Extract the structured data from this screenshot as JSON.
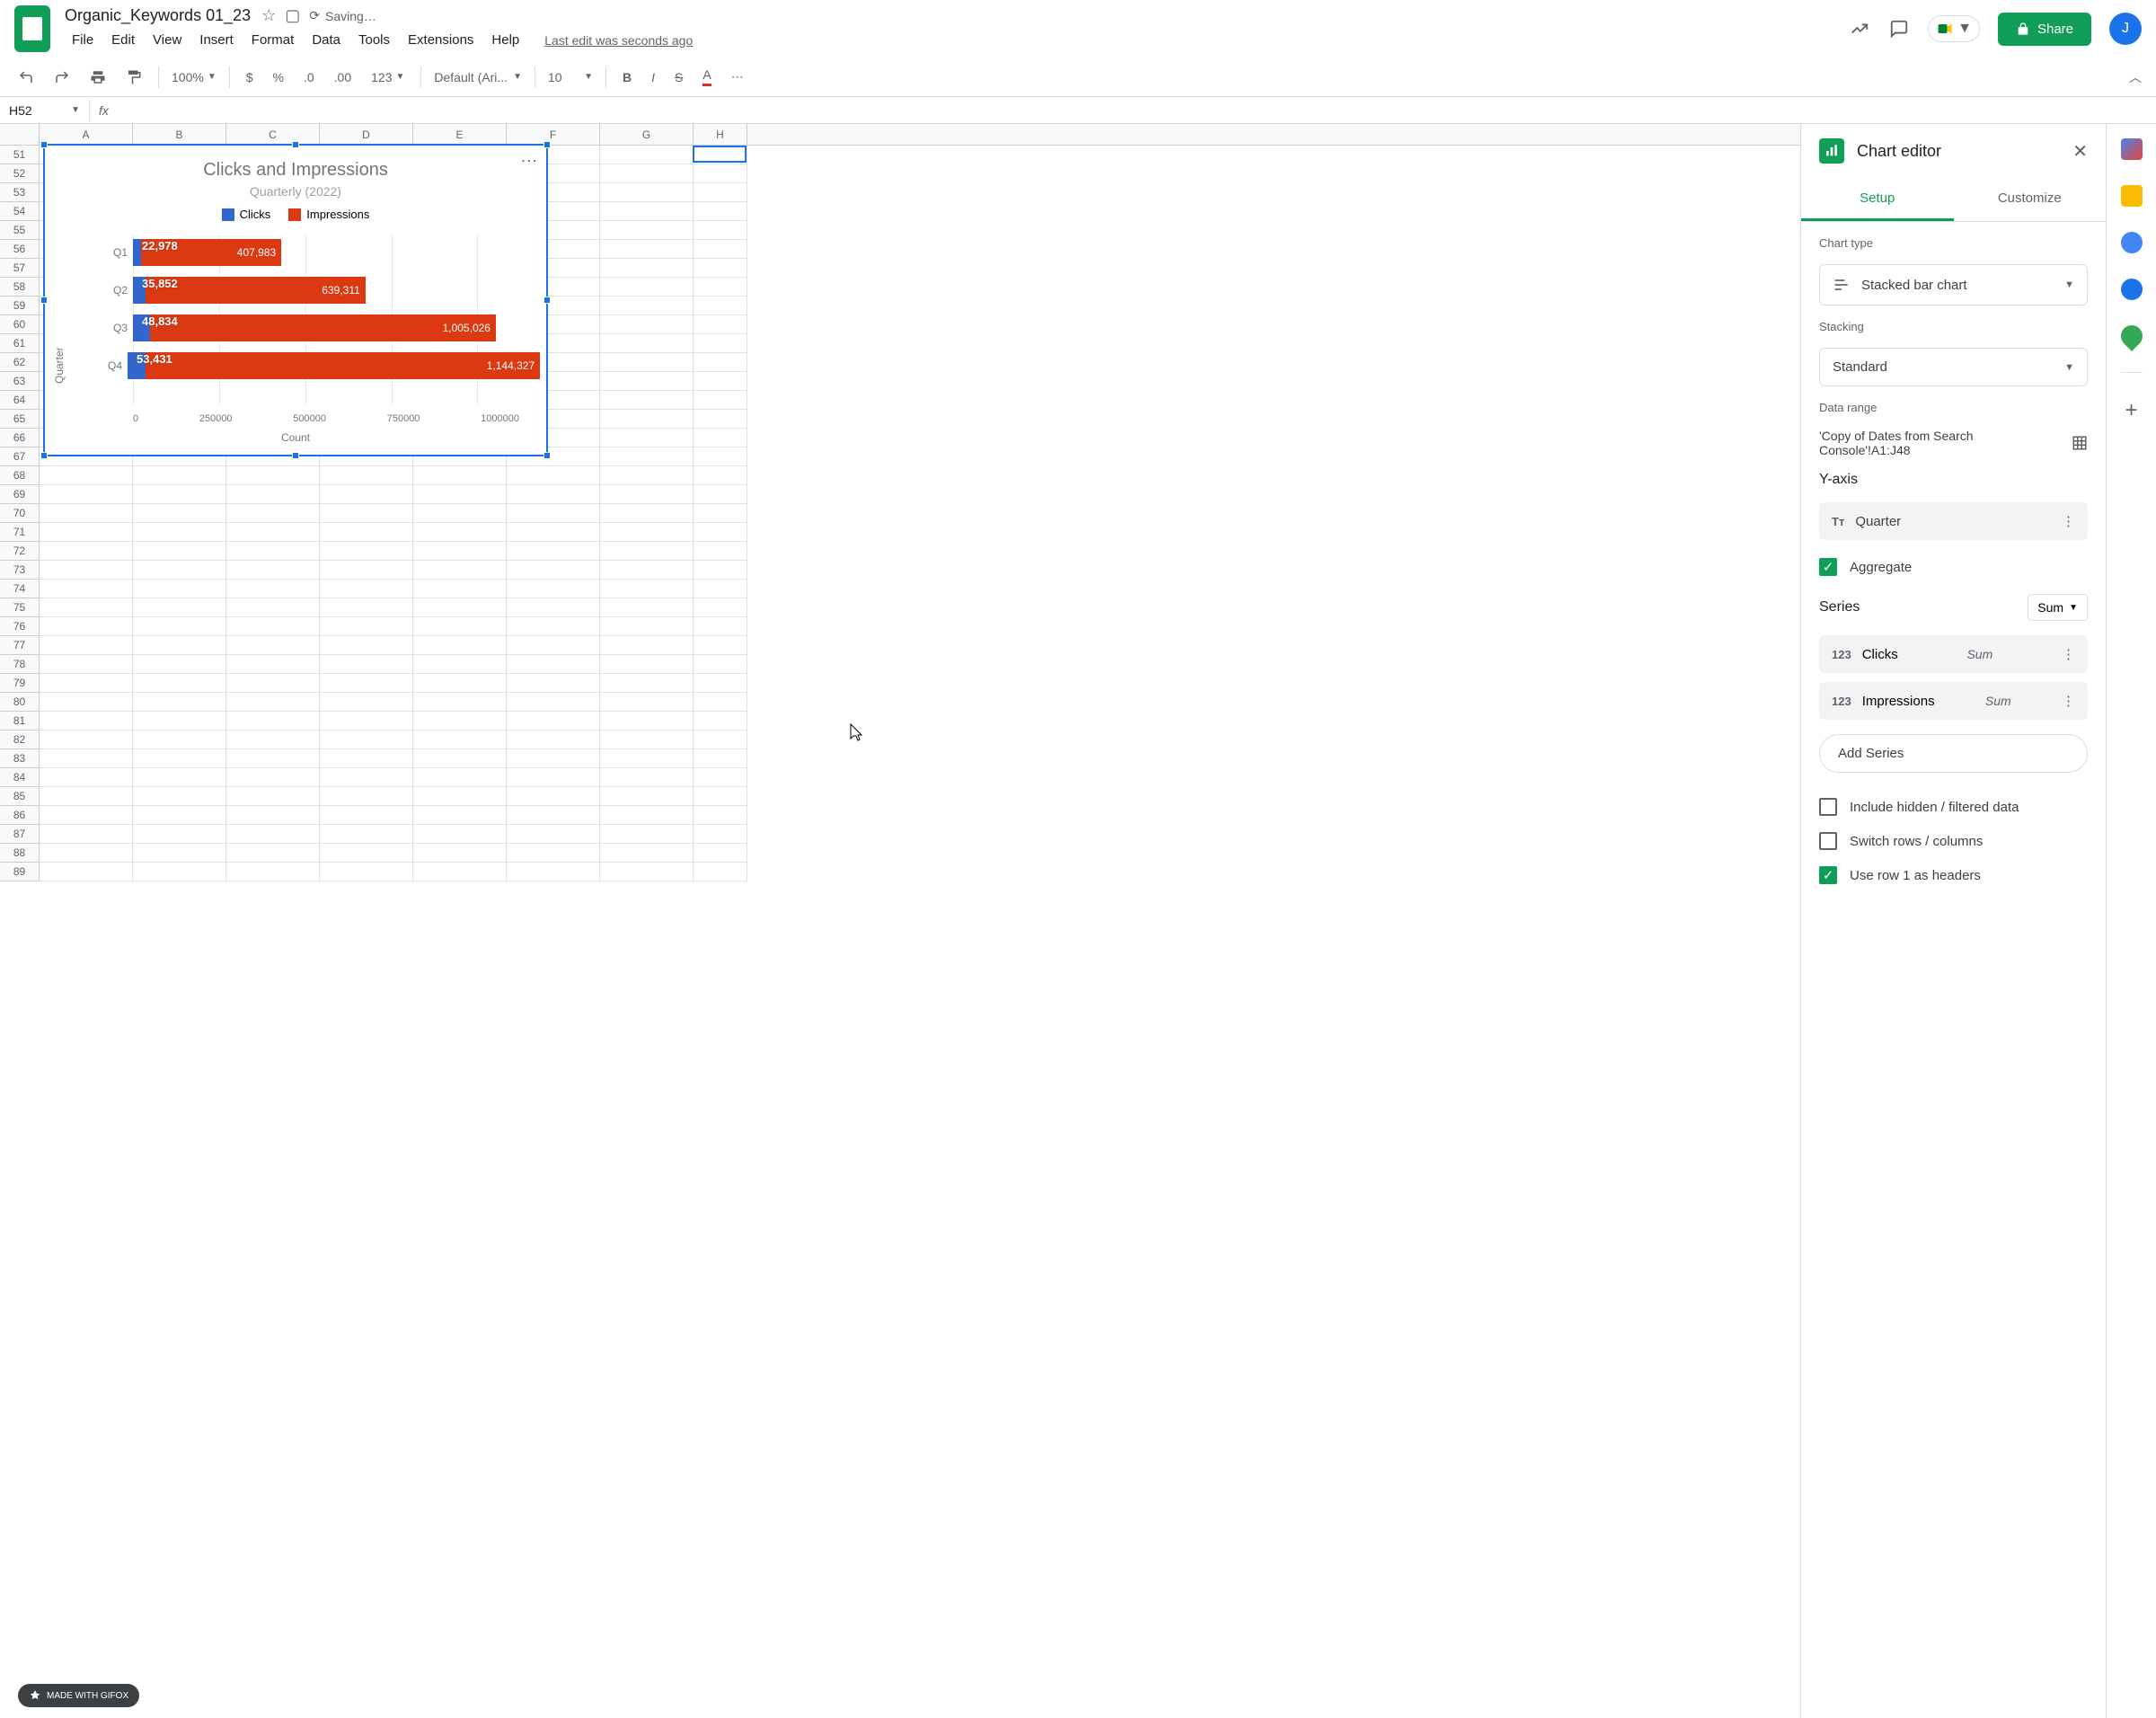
{
  "doc": {
    "title": "Organic_Keywords 01_23",
    "saving": "Saving…",
    "last_edit": "Last edit was seconds ago"
  },
  "menubar": [
    "File",
    "Edit",
    "View",
    "Insert",
    "Format",
    "Data",
    "Tools",
    "Extensions",
    "Help"
  ],
  "toolbar": {
    "zoom": "100%",
    "font": "Default (Ari...",
    "font_size": "10",
    "number_fmt": "123"
  },
  "share": "Share",
  "avatar_initial": "J",
  "cell_ref": "H52",
  "columns": [
    "A",
    "B",
    "C",
    "D",
    "E",
    "F",
    "G",
    "H"
  ],
  "rows_start": 51,
  "rows_end": 89,
  "chart_editor": {
    "title": "Chart editor",
    "tabs": {
      "setup": "Setup",
      "customize": "Customize"
    },
    "chart_type_label": "Chart type",
    "chart_type_value": "Stacked bar chart",
    "stacking_label": "Stacking",
    "stacking_value": "Standard",
    "data_range_label": "Data range",
    "data_range_value": "'Copy of Dates from Search Console'!A1:J48",
    "y_axis_label": "Y-axis",
    "y_axis_value": "Quarter",
    "aggregate": "Aggregate",
    "series_label": "Series",
    "series_agg": "Sum",
    "series": [
      {
        "name": "Clicks",
        "agg": "Sum"
      },
      {
        "name": "Impressions",
        "agg": "Sum"
      }
    ],
    "add_series": "Add Series",
    "include_hidden": "Include hidden / filtered data",
    "switch_rows": "Switch rows / columns",
    "use_row1": "Use row 1 as headers"
  },
  "chart_data": {
    "type": "bar",
    "title": "Clicks and Impressions",
    "subtitle": "Quarterly (2022)",
    "xlabel": "Count",
    "ylabel": "Quarter",
    "xlim": [
      0,
      1200000
    ],
    "xticks": [
      0,
      250000,
      500000,
      750000,
      1000000
    ],
    "categories": [
      "Q1",
      "Q2",
      "Q3",
      "Q4"
    ],
    "series": [
      {
        "name": "Clicks",
        "color": "#3366cc",
        "values": [
          22978,
          35852,
          48834,
          53431
        ],
        "labels": [
          "22,978",
          "35,852",
          "48,834",
          "53,431"
        ]
      },
      {
        "name": "Impressions",
        "color": "#dc3912",
        "values": [
          407983,
          639311,
          1005026,
          1144327
        ],
        "labels": [
          "407,983",
          "639,311",
          "1,005,026",
          "1,144,327"
        ]
      }
    ]
  },
  "gifox": "MADE WITH GIFOX"
}
